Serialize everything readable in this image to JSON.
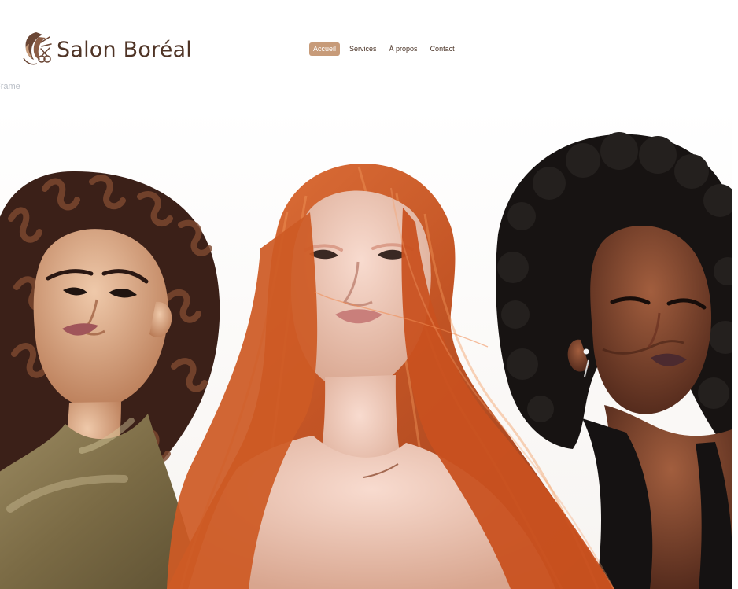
{
  "brand": {
    "name": "Salon Boréal",
    "logo_icon": "hair-scissors-logo-icon"
  },
  "nav": {
    "items": [
      {
        "label": "Accueil",
        "active": true
      },
      {
        "label": "Services",
        "active": false
      },
      {
        "label": "À propos",
        "active": false
      },
      {
        "label": "Contact",
        "active": false
      }
    ]
  },
  "editor": {
    "frame_label": "Frame"
  },
  "hero": {
    "image_icon": "hero-portrait-image"
  },
  "colors": {
    "accent": "#c79b79",
    "brand_text": "#4f3426",
    "background": "#ffffff"
  }
}
